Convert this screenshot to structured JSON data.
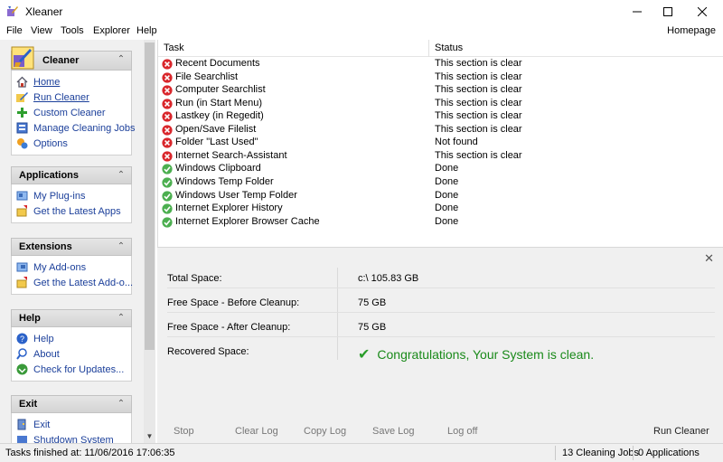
{
  "window": {
    "title": "Xleaner"
  },
  "menu": {
    "items": [
      "File",
      "View",
      "Tools",
      "Explorer",
      "Help"
    ],
    "homepage": "Homepage"
  },
  "sidebar": {
    "panels": [
      {
        "title": "Cleaner",
        "items": [
          {
            "label": "Home",
            "icon": "home-icon"
          },
          {
            "label": "Run Cleaner",
            "icon": "run-icon"
          },
          {
            "label": "Custom Cleaner",
            "icon": "plus-icon"
          },
          {
            "label": "Manage Cleaning Jobs",
            "icon": "jobs-icon"
          },
          {
            "label": "Options",
            "icon": "options-icon"
          }
        ]
      },
      {
        "title": "Applications",
        "items": [
          {
            "label": "My Plug-ins",
            "icon": "plugin-icon"
          },
          {
            "label": "Get the Latest Apps",
            "icon": "download-icon"
          }
        ]
      },
      {
        "title": "Extensions",
        "items": [
          {
            "label": "My Add-ons",
            "icon": "addon-icon"
          },
          {
            "label": "Get the Latest Add-o...",
            "icon": "download-icon"
          }
        ]
      },
      {
        "title": "Help",
        "items": [
          {
            "label": "Help",
            "icon": "help-icon"
          },
          {
            "label": "About",
            "icon": "about-icon"
          },
          {
            "label": "Check for Updates...",
            "icon": "update-icon"
          }
        ]
      },
      {
        "title": "Exit",
        "items": [
          {
            "label": "Exit",
            "icon": "exit-icon"
          },
          {
            "label": "Shutdown System",
            "icon": "shutdown-icon"
          }
        ]
      }
    ]
  },
  "tasks": {
    "headers": {
      "task": "Task",
      "status": "Status"
    },
    "rows": [
      {
        "name": "Recent Documents",
        "status": "This section is clear",
        "state": "error"
      },
      {
        "name": "File Searchlist",
        "status": "This section is clear",
        "state": "error"
      },
      {
        "name": "Computer Searchlist",
        "status": "This section is clear",
        "state": "error"
      },
      {
        "name": "Run (in Start Menu)",
        "status": "This section is clear",
        "state": "error"
      },
      {
        "name": "Lastkey (in Regedit)",
        "status": "This section is clear",
        "state": "error"
      },
      {
        "name": "Open/Save Filelist",
        "status": "This section is clear",
        "state": "error"
      },
      {
        "name": "Folder \"Last Used\"",
        "status": "Not found",
        "state": "error"
      },
      {
        "name": "Internet Search-Assistant",
        "status": "This section is clear",
        "state": "error"
      },
      {
        "name": "Windows Clipboard",
        "status": "Done",
        "state": "ok"
      },
      {
        "name": "Windows Temp Folder",
        "status": "Done",
        "state": "ok"
      },
      {
        "name": "Windows User Temp Folder",
        "status": "Done",
        "state": "ok"
      },
      {
        "name": "Internet Explorer History",
        "status": "Done",
        "state": "ok"
      },
      {
        "name": "Internet Explorer Browser Cache",
        "status": "Done",
        "state": "ok"
      }
    ]
  },
  "info": {
    "total_space_label": "Total Space:",
    "total_space_value": "c:\\ 105.83 GB",
    "free_before_label": "Free Space - Before Cleanup:",
    "free_before_value": "75 GB",
    "free_after_label": "Free Space - After Cleanup:",
    "free_after_value": "75 GB",
    "recovered_label": "Recovered Space:",
    "congrats": "Congratulations, Your System is clean."
  },
  "actions": {
    "stop": "Stop",
    "clear_log": "Clear Log",
    "copy_log": "Copy Log",
    "save_log": "Save Log",
    "log_off": "Log off",
    "run_cleaner": "Run Cleaner"
  },
  "status": {
    "finished": "Tasks finished at: 11/06/2016 17:06:35",
    "jobs": "13 Cleaning Jobs",
    "apps": "0 Applications"
  },
  "colors": {
    "link": "#1b3f9a",
    "success": "#1a8a1a",
    "error": "#d9262b",
    "ok": "#4caf50"
  }
}
